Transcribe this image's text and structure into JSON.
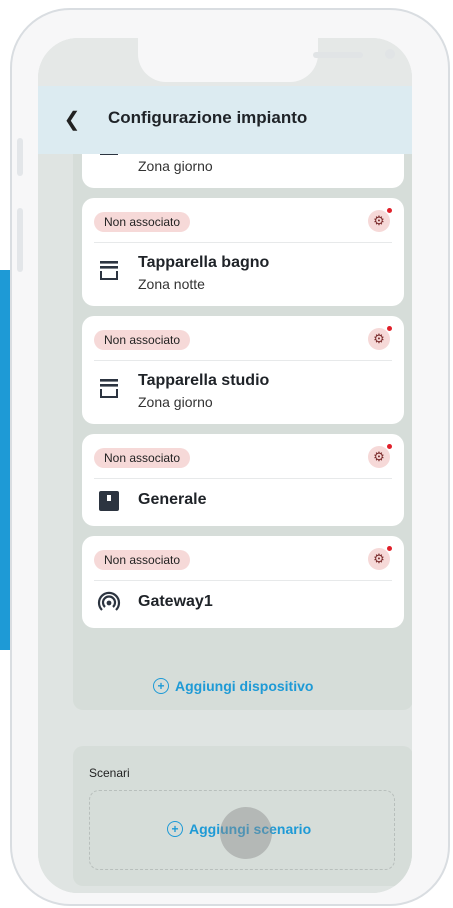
{
  "header": {
    "title": "Configurazione impianto"
  },
  "devices": [
    {
      "name": "",
      "zone": "Zona giorno",
      "badge": "",
      "icon": "shutter-icon"
    },
    {
      "name": "Tapparella bagno",
      "zone": "Zona notte",
      "badge": "Non associato",
      "icon": "shutter-icon"
    },
    {
      "name": "Tapparella studio",
      "zone": "Zona giorno",
      "badge": "Non associato",
      "icon": "shutter-icon"
    },
    {
      "name": "Generale",
      "zone": "",
      "badge": "Non associato",
      "icon": "switch-icon"
    },
    {
      "name": "Gateway1",
      "zone": "",
      "badge": "Non associato",
      "icon": "gateway-icon"
    }
  ],
  "add_device_label": "Aggiungi dispositivo",
  "scenari": {
    "title": "Scenari",
    "add_label": "Aggiungi scenario"
  },
  "colors": {
    "accent": "#1e9ad6",
    "badge_bg": "#f6d9d8",
    "header_bg": "#dcebf1"
  }
}
